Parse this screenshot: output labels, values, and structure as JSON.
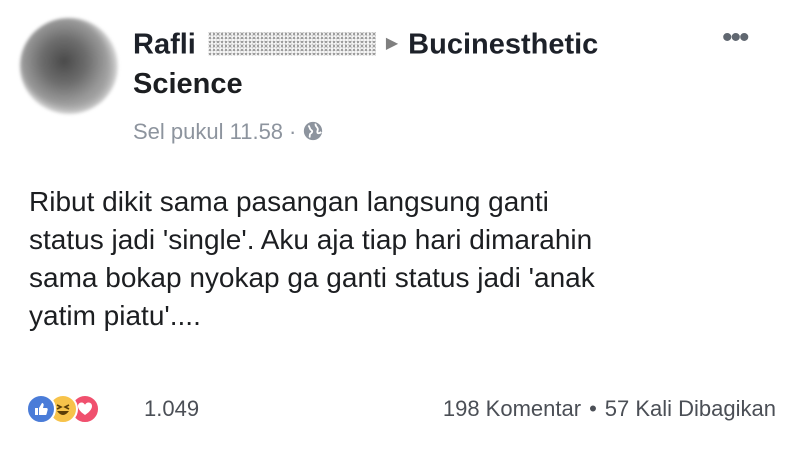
{
  "post": {
    "author": "Rafli",
    "group": "Bucinesthetic Science",
    "group_line1": "Bucinesthetic",
    "group_line2": "Science",
    "timestamp": "Sel pukul 11.58",
    "privacy_icon": "globe-icon",
    "more_icon": "•••",
    "message_lines": [
      "Ribut dikit sama pasangan langsung ganti",
      "status jadi 'single'. Aku aja tiap hari dimarahin",
      "sama bokap nyokap ga ganti status jadi 'anak",
      "yatim piatu'...."
    ]
  },
  "footer": {
    "reactions": [
      "like-icon",
      "haha-icon",
      "love-icon"
    ],
    "reaction_count": "1.049",
    "comments": "198 Komentar",
    "separator": "•",
    "shares": "57 Kali Dibagikan"
  },
  "colors": {
    "text": "#1c1e21",
    "meta": "#8d949e",
    "like": "#4a7cd8",
    "haha": "#f7c34a",
    "love": "#f0506e"
  }
}
